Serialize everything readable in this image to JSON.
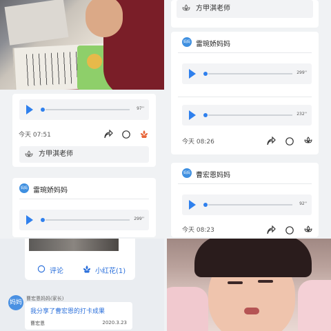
{
  "left_column": {
    "card1": {
      "audio_duration": "97''",
      "time": "今天 07:51",
      "teacher": "方甲淇老师"
    },
    "card2": {
      "avatar_text": "妈妈",
      "name": "雷琬娇妈妈",
      "audio_duration": "299''"
    }
  },
  "right_column": {
    "top_teacher": "方甲淇老师",
    "card1": {
      "avatar_text": "妈妈",
      "name": "雷琬娇妈妈",
      "audio_duration": "299''",
      "audio2_duration": "232''",
      "time": "今天 08:26"
    },
    "card2": {
      "avatar_text": "妈妈",
      "name": "曹宏恩妈妈",
      "audio_duration": "92''",
      "time": "今天 08:23"
    }
  },
  "bottom_left": {
    "comment_label": "评论",
    "flower_label": "小红花(1)",
    "poster_avatar": "妈妈",
    "poster_name": "曹宏恩妈妈(家长)",
    "share_text": "我分享了曹宏恩的打卡成果",
    "share_user": "曹宏恩",
    "share_date": "2020.3.23"
  },
  "colors": {
    "accent": "#2f80ed",
    "flower": "#e8663a"
  }
}
